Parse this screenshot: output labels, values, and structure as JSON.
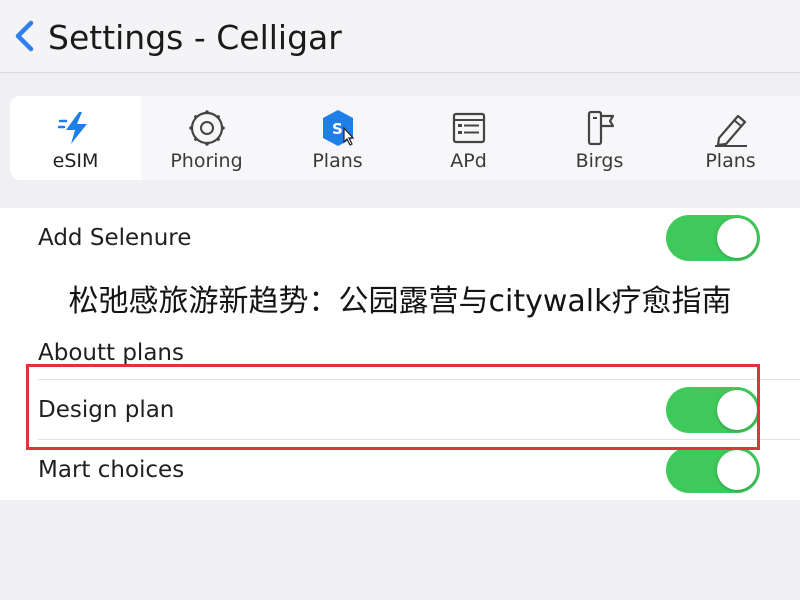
{
  "navbar": {
    "back_icon": "chevron-left-icon",
    "title": "Settings - Celligar",
    "accent_color": "#2f7ff0"
  },
  "tabs": [
    {
      "label": "eSIM",
      "icon": "lightning-bolt-icon",
      "active": true
    },
    {
      "label": "Phoring",
      "icon": "gear-ring-icon",
      "active": false
    },
    {
      "label": "Plans",
      "icon": "sim-badge-icon",
      "active": false
    },
    {
      "label": "APd",
      "icon": "list-card-icon",
      "active": false
    },
    {
      "label": "Birgs",
      "icon": "flag-device-icon",
      "active": false
    },
    {
      "label": "Plans",
      "icon": "pencil-icon",
      "active": false
    }
  ],
  "rows": [
    {
      "label": "Add Selenure",
      "toggle": true
    },
    {
      "label": "Aboutt plans"
    },
    {
      "label": "Design plan",
      "toggle": true
    },
    {
      "label": "Mart choices",
      "toggle": true
    }
  ],
  "overlay": {
    "caption": "松弛感旅游新趋势：公园露营与citywalk疗愈指南"
  },
  "colors": {
    "toggle_on": "#3fc95a",
    "highlight": "#e0343a"
  }
}
